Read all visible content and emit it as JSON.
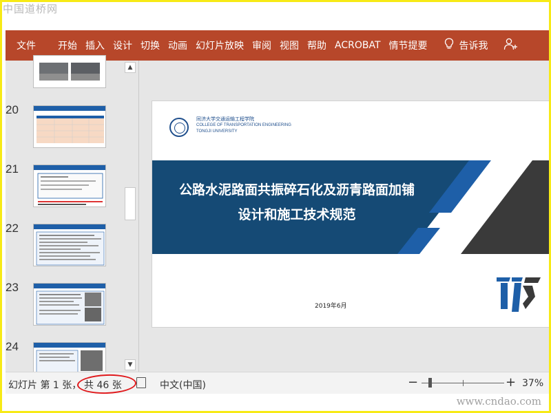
{
  "watermarks": {
    "top": "中国道桥网",
    "bottom": "www.cndao.com"
  },
  "ribbon": {
    "tabs": [
      "文件",
      "开始",
      "插入",
      "设计",
      "切换",
      "动画",
      "幻灯片放映",
      "审阅",
      "视图",
      "帮助",
      "ACROBAT",
      "情节提要"
    ],
    "tell_me": "告诉我",
    "tell_me_icon": "lightbulb-icon",
    "share_icon": "person-add-icon"
  },
  "thumbnails": {
    "numbers": [
      "20",
      "21",
      "22",
      "23",
      "24"
    ]
  },
  "slide": {
    "college_cn": "同济大学交通运输工程学院",
    "college_en1": "COLLEGE OF TRANSPORTATION ENGINEERING",
    "college_en2": "TONGJI UNIVERSITY",
    "title_line1": "公路水泥路面共振碎石化及沥青路面加铺",
    "title_line2": "设计和施工技术规范",
    "date": "2019年6月"
  },
  "statusbar": {
    "slide_pos": "幻灯片 第 1 张，",
    "slide_total": "共 46 张",
    "language": "中文(中国)",
    "zoom": "37%",
    "zoom_level_percent": 37
  },
  "colors": {
    "ribbon": "#b7472a",
    "band_blue": "#154a75",
    "band_dark": "#3a3a3a",
    "highlight_ellipse": "#e0181b",
    "frame": "#f7ea16"
  }
}
